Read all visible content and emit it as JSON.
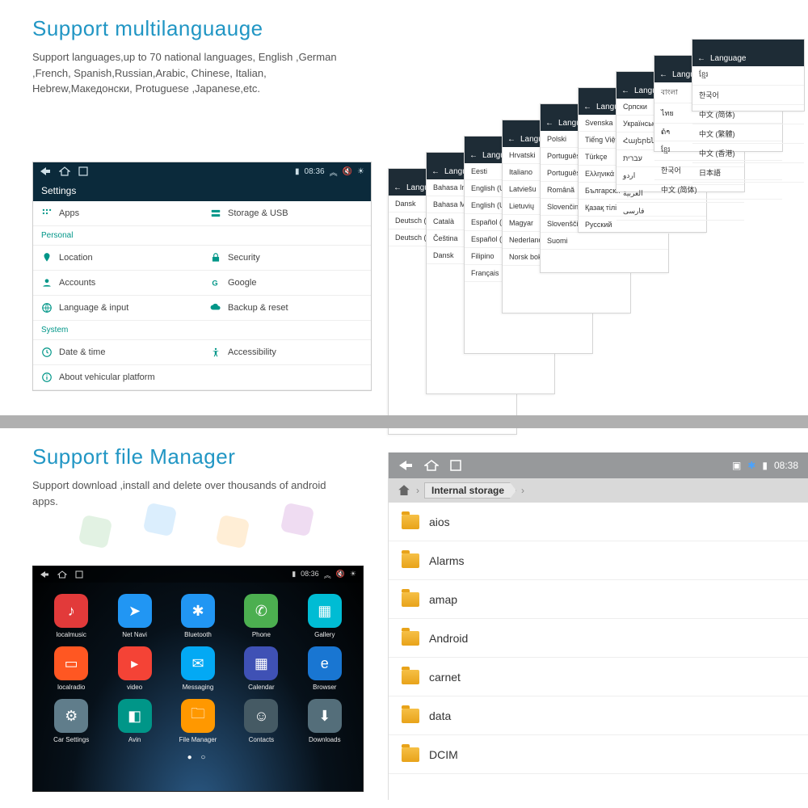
{
  "section1": {
    "title": "Support multilanguauge",
    "desc": "Support languages,up to 70 national languages, English ,German ,French, Spanish,Russian,Arabic, Chinese, Italian, Hebrew,Македонски, Protuguese ,Japanese,etc."
  },
  "section2": {
    "title": "Support file Manager",
    "desc": "Support download ,install and delete over thousands of android apps."
  },
  "settings": {
    "time": "08:36",
    "header": "Settings",
    "cat_personal": "Personal",
    "cat_system": "System",
    "items": {
      "apps": "Apps",
      "storage": "Storage & USB",
      "location": "Location",
      "security": "Security",
      "accounts": "Accounts",
      "google": "Google",
      "language": "Language & input",
      "backup": "Backup & reset",
      "date": "Date & time",
      "access": "Accessibility",
      "about": "About vehicular platform"
    }
  },
  "lang": {
    "header": "Language",
    "cards": [
      {
        "items": [
          "Dansk",
          "Deutsch (Deuts",
          "Deutsch (Österreich)"
        ]
      },
      {
        "items": [
          "Bahasa Ind",
          "Bahasa Mel",
          "Català",
          "Čeština",
          "Dansk"
        ]
      },
      {
        "items": [
          "Eesti",
          "English (Un",
          "English (Un",
          "Español (Es",
          "Español (Es",
          "Filipino",
          "Français"
        ]
      },
      {
        "items": [
          "Hrvatski",
          "Italiano",
          "Latviešu",
          "Lietuvių",
          "Magyar",
          "Nederlands",
          "Norsk bokmål"
        ]
      },
      {
        "items": [
          "Polski",
          "Português (Brasil)",
          "Português (Portug",
          "Română",
          "Slovenčina",
          "Slovenščina",
          "Suomi"
        ]
      },
      {
        "items": [
          "Svenska",
          "Tiếng Việt",
          "Türkçe",
          "Ελληνικά",
          "Български",
          "Қазақ тілі",
          "Русский"
        ]
      },
      {
        "items": [
          "Српски",
          "Українська",
          "Հայերեն",
          "עברית",
          "اردو",
          "العربية",
          "فارسی"
        ]
      },
      {
        "items": [
          "বাংলা",
          "ไทย",
          "ຄຳ",
          "ខ្មែរ",
          "한국어",
          "中文 (简体)"
        ]
      },
      {
        "items": [
          "ខ្មែរ",
          "한국어",
          "中文 (简体)",
          "中文 (繁體)",
          "中文 (香港)",
          "日本語"
        ]
      }
    ]
  },
  "launcher": {
    "time": "08:36",
    "apps": [
      {
        "label": "localmusic",
        "bg": "#e23a3a",
        "glyph": "♪"
      },
      {
        "label": "Net Navi",
        "bg": "#2196f3",
        "glyph": "➤"
      },
      {
        "label": "Bluetooth",
        "bg": "#2196f3",
        "glyph": "✱"
      },
      {
        "label": "Phone",
        "bg": "#4caf50",
        "glyph": "✆"
      },
      {
        "label": "Gallery",
        "bg": "#00bcd4",
        "glyph": "▦"
      },
      {
        "label": "localradio",
        "bg": "#ff5722",
        "glyph": "▭"
      },
      {
        "label": "video",
        "bg": "#f44336",
        "glyph": "▸"
      },
      {
        "label": "Messaging",
        "bg": "#03a9f4",
        "glyph": "✉"
      },
      {
        "label": "Calendar",
        "bg": "#3f51b5",
        "glyph": "▦"
      },
      {
        "label": "Browser",
        "bg": "#1976d2",
        "glyph": "e"
      },
      {
        "label": "Car Settings",
        "bg": "#607d8b",
        "glyph": "⚙"
      },
      {
        "label": "Avin",
        "bg": "#009688",
        "glyph": "◧"
      },
      {
        "label": "File Manager",
        "bg": "#ff9800",
        "glyph": "🗀"
      },
      {
        "label": "Contacts",
        "bg": "#455a64",
        "glyph": "☺"
      },
      {
        "label": "Downloads",
        "bg": "#546e7a",
        "glyph": "⬇"
      }
    ]
  },
  "filemanager": {
    "time": "08:38",
    "crumb": "Internal storage",
    "folders": [
      "aios",
      "Alarms",
      "amap",
      "Android",
      "carnet",
      "data",
      "DCIM"
    ]
  }
}
